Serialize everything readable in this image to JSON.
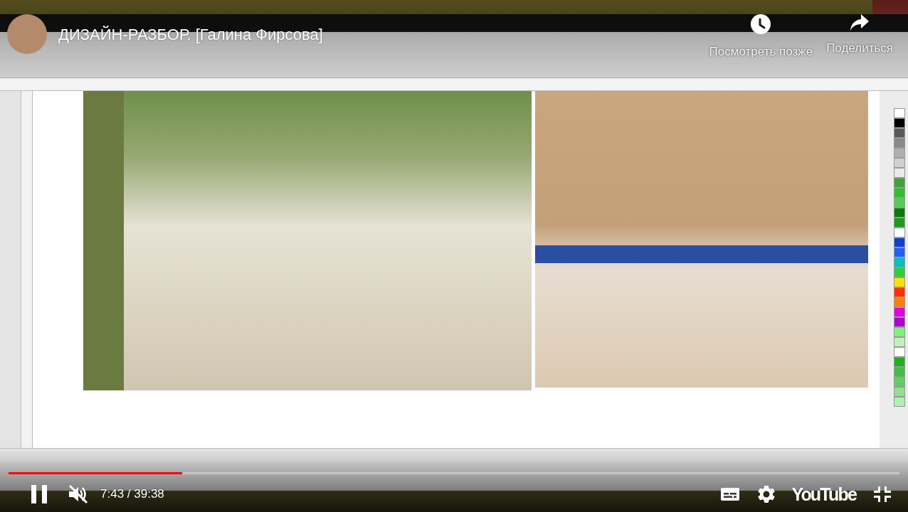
{
  "player": {
    "title": "ДИЗАЙН-РАЗБОР. [Галина Фирсова]",
    "watch_later": {
      "label": "Посмотреть позже"
    },
    "share": {
      "label": "Поделиться"
    },
    "progress": {
      "level": 0.195
    },
    "playing": true,
    "muted": true,
    "time": "7:43 / 39:38",
    "logo": "YouTube",
    "fullscreen": true
  }
}
